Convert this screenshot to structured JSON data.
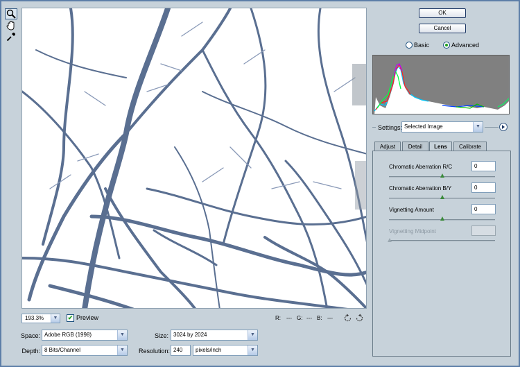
{
  "tools": [
    "zoom-tool",
    "hand-tool",
    "white-balance-eyedropper"
  ],
  "status": {
    "zoom": "193.3%",
    "preview_label": "Preview",
    "preview_checked": true,
    "r_label": "R:",
    "r_value": "---",
    "g_label": "G:",
    "g_value": "---",
    "b_label": "B:",
    "b_value": "---"
  },
  "fields": {
    "space_label": "Space:",
    "space_value": "Adobe RGB (1998)",
    "depth_label": "Depth:",
    "depth_value": "8 Bits/Channel",
    "size_label": "Size:",
    "size_value": "3024 by 2024",
    "resolution_label": "Resolution:",
    "resolution_value": "240",
    "resolution_unit": "pixels/inch"
  },
  "buttons": {
    "ok": "OK",
    "cancel": "Cancel"
  },
  "mode": {
    "basic": "Basic",
    "advanced": "Advanced",
    "selected": "Advanced"
  },
  "settings": {
    "label": "Settings:",
    "value": "Selected Image"
  },
  "tabs": [
    {
      "label": "Adjust",
      "active": false
    },
    {
      "label": "Detail",
      "active": false
    },
    {
      "label": "Lens",
      "active": true
    },
    {
      "label": "Calibrate",
      "active": false
    }
  ],
  "lens": {
    "ca_rc": {
      "label": "Chromatic Aberration R/C",
      "value": "0"
    },
    "ca_by": {
      "label": "Chromatic Aberration B/Y",
      "value": "0"
    },
    "vignetting_amount": {
      "label": "Vignetting Amount",
      "value": "0"
    },
    "vignetting_midpoint": {
      "label": "Vignetting Midpoint",
      "value": "",
      "disabled": true
    }
  },
  "colors": {
    "frame": "#5d7ea8",
    "panel": "#c7d2da",
    "accent_green": "#21a121"
  }
}
